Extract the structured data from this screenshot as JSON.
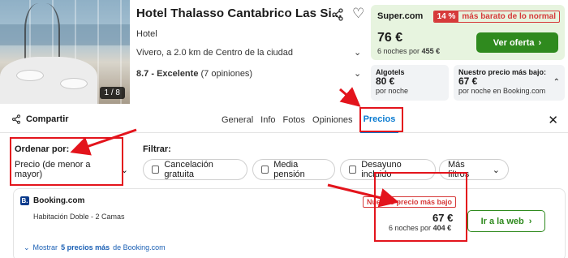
{
  "hotel": {
    "name": "Hotel Thalasso Cantabrico Las Si...",
    "type": "Hotel",
    "location": "Vivero, a 2.0 km de Centro de la ciudad",
    "rating_score": "8.7 - Excelente",
    "rating_count": "(7 opiniones)",
    "photo_counter": "1 / 8"
  },
  "best_deal": {
    "provider": "Super.com",
    "discount_pct": "14 %",
    "discount_text": "más barato de lo normal",
    "price": "76 €",
    "nights_text": "6 noches por",
    "nights_total": "455 €",
    "cta_label": "Ver oferta"
  },
  "alt_prices": [
    {
      "provider": "Algotels",
      "price": "80 €",
      "caption": "por noche"
    },
    {
      "provider": "Nuestro precio más bajo:",
      "price": "67 €",
      "caption": "por noche en Booking.com"
    }
  ],
  "tabs_bar": {
    "share_label": "Compartir",
    "tabs": [
      "General",
      "Info",
      "Fotos",
      "Opiniones",
      "Precios"
    ],
    "active_tab": "Precios"
  },
  "filters": {
    "sort_label": "Ordenar por:",
    "sort_value": "Precio (de menor a mayor)",
    "filter_label": "Filtrar:",
    "chips": [
      "Cancelación gratuita",
      "Media pensión",
      "Desayuno incluido",
      "Más filtros"
    ]
  },
  "offer": {
    "provider": "Booking.com",
    "room": "Habitación Doble - 2 Camas",
    "tag": "Nuestro precio más bajo",
    "price": "67 €",
    "nights_text": "6 noches por",
    "nights_total": "404 €",
    "cta_label": "Ir a la web",
    "more_prefix": "Mostrar",
    "more_count": "5 precios más",
    "more_suffix": "de Booking.com"
  },
  "colors": {
    "accent_blue": "#0a7bd1",
    "deal_green": "#2f8a1e",
    "deal_bg": "#e7f4df",
    "discount_red": "#d63a3a",
    "annotation_red": "#e3141c"
  }
}
